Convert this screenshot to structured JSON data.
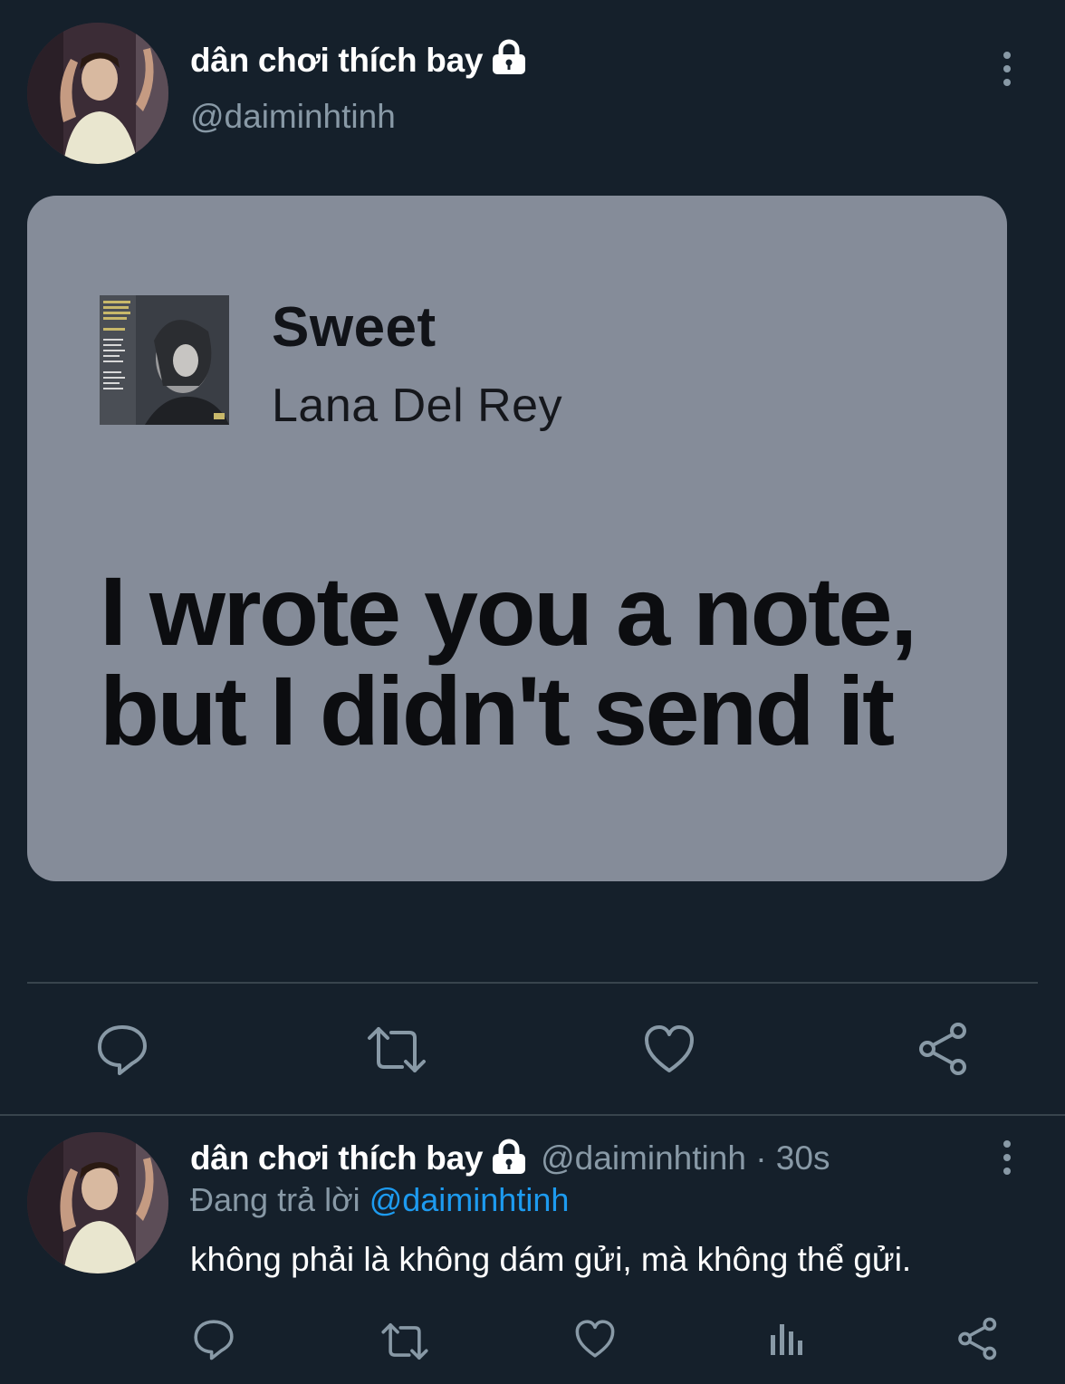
{
  "main_tweet": {
    "author": {
      "display_name": "dân chơi thích bay",
      "handle": "@daiminhtinh",
      "protected_icon": "lock-icon",
      "avatar_icon": "avatar"
    },
    "more_icon": "more-options-icon",
    "media": {
      "song_title": "Sweet",
      "artist": "Lana Del Rey",
      "album_art_icon": "album-cover",
      "lyric_line_1": "I wrote you a note,",
      "lyric_line_2": "but I didn't send it"
    },
    "actions": [
      {
        "icon": "reply-icon"
      },
      {
        "icon": "retweet-icon"
      },
      {
        "icon": "like-icon"
      },
      {
        "icon": "share-icon"
      }
    ]
  },
  "reply_tweet": {
    "author": {
      "display_name": "dân chơi thích bay",
      "protected_icon": "lock-icon",
      "handle_time": "@daiminhtinh · 30s"
    },
    "reply_prefix": "Đang trả lời",
    "reply_mention": "@daiminhtinh",
    "text": "không phải là không dám gửi, mà không thể gửi.",
    "actions": [
      {
        "icon": "reply-icon"
      },
      {
        "icon": "retweet-icon"
      },
      {
        "icon": "like-icon"
      },
      {
        "icon": "analytics-icon"
      },
      {
        "icon": "share-icon"
      }
    ]
  },
  "colors": {
    "background": "#15202b",
    "secondary_text": "#8899a6",
    "link": "#1d9bf0",
    "card_background": "#858c99",
    "divider": "#38444d"
  }
}
